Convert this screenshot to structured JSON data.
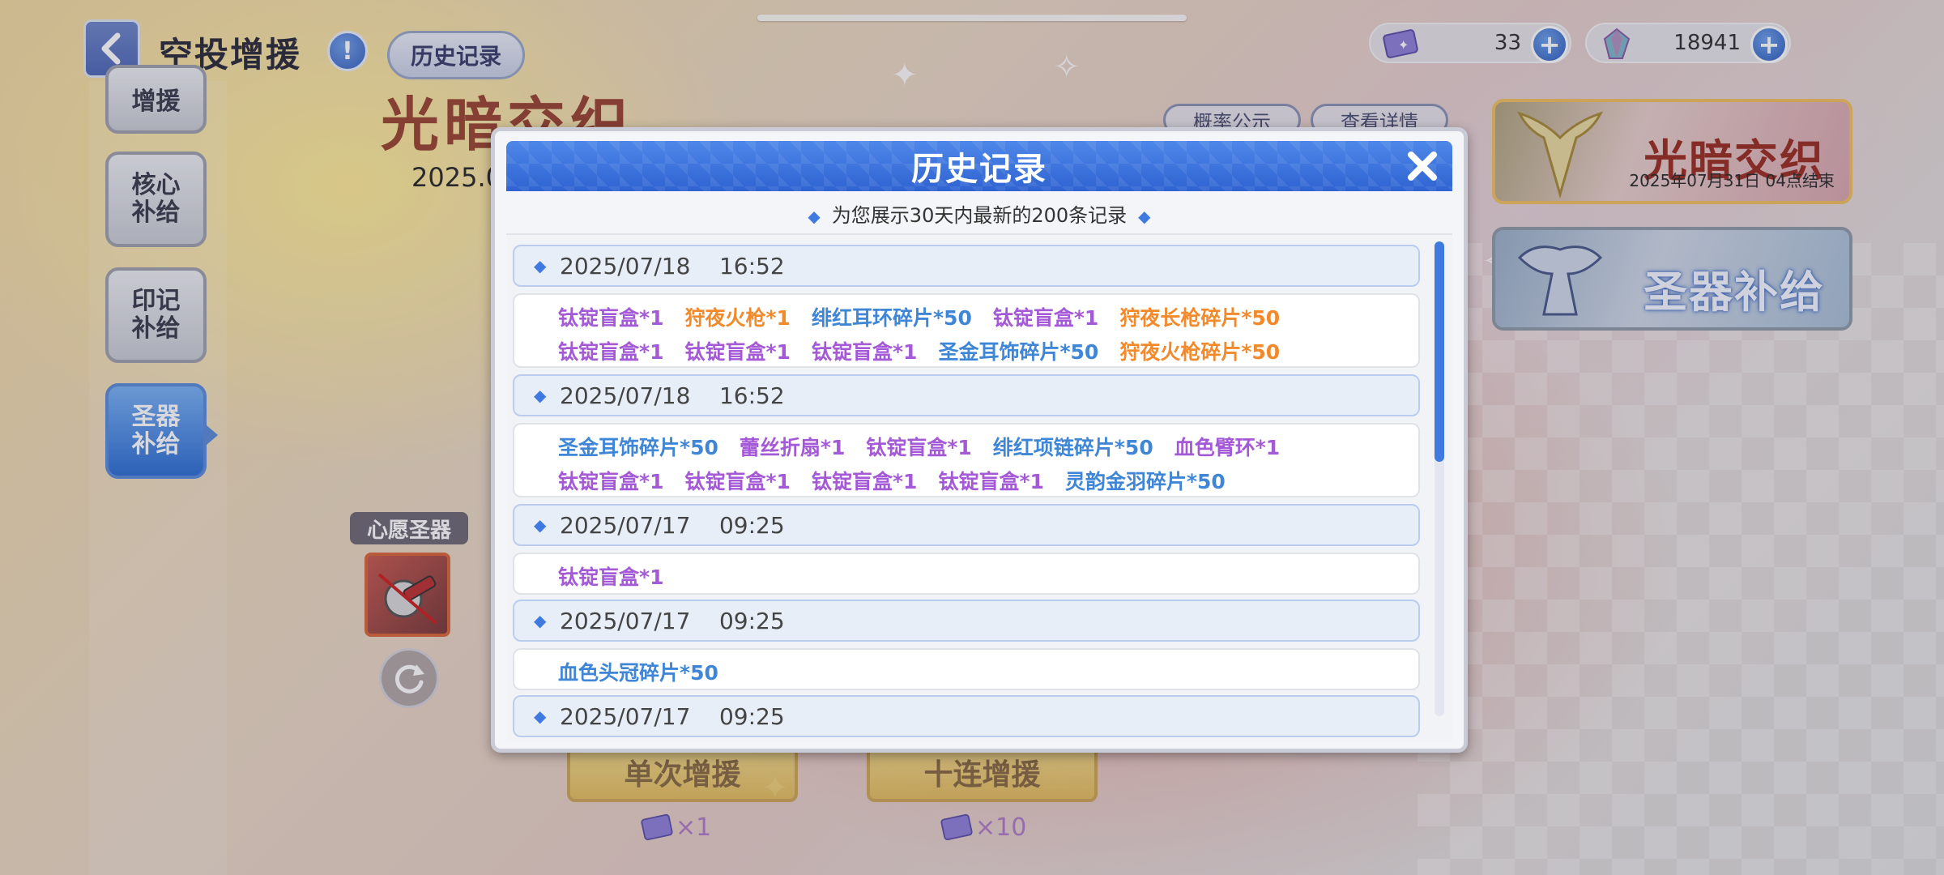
{
  "header": {
    "title": "空投增援",
    "history_button": "历史记录"
  },
  "currencies": [
    {
      "icon": "ticket-icon",
      "value": "33"
    },
    {
      "icon": "crystal-icon",
      "value": "18941"
    }
  ],
  "sidebar": {
    "tabs": [
      {
        "label": "增援",
        "active": false
      },
      {
        "label": "核心\n补给",
        "active": false
      },
      {
        "label": "印记\n补给",
        "active": false
      },
      {
        "label": "圣器\n补给",
        "active": true
      }
    ]
  },
  "wish": {
    "label": "心愿圣器"
  },
  "background": {
    "event_title": "光暗交织",
    "event_date": "2025.0",
    "small_btn_1": "概率公示",
    "small_btn_2": "查看详情",
    "single_pull": "单次增援",
    "ten_pull": "十连增援",
    "single_cost": "×1",
    "ten_cost": "×10"
  },
  "banners": [
    {
      "title": "光暗交织",
      "subtitle": "2025年07月31日 04点结束"
    },
    {
      "title": "圣器补给",
      "subtitle": ""
    }
  ],
  "modal": {
    "title": "历史记录",
    "subtitle": "为您展示30天内最新的200条记录",
    "records": [
      {
        "date": "2025/07/18    16:52",
        "items": [
          {
            "text": "钛锭盲盒*1",
            "color": "purple"
          },
          {
            "text": "狩夜火枪*1",
            "color": "orange"
          },
          {
            "text": "绯红耳环碎片*50",
            "color": "blue"
          },
          {
            "text": "钛锭盲盒*1",
            "color": "purple"
          },
          {
            "text": "狩夜长枪碎片*50",
            "color": "orange"
          },
          {
            "text": "钛锭盲盒*1",
            "color": "purple"
          },
          {
            "text": "钛锭盲盒*1",
            "color": "purple"
          },
          {
            "text": "钛锭盲盒*1",
            "color": "purple"
          },
          {
            "text": "圣金耳饰碎片*50",
            "color": "blue"
          },
          {
            "text": "狩夜火枪碎片*50",
            "color": "orange"
          }
        ]
      },
      {
        "date": "2025/07/18    16:52",
        "items": [
          {
            "text": "圣金耳饰碎片*50",
            "color": "blue"
          },
          {
            "text": "蕾丝折扇*1",
            "color": "purple"
          },
          {
            "text": "钛锭盲盒*1",
            "color": "purple"
          },
          {
            "text": "绯红项链碎片*50",
            "color": "blue"
          },
          {
            "text": "血色臂环*1",
            "color": "purple"
          },
          {
            "text": "钛锭盲盒*1",
            "color": "purple"
          },
          {
            "text": "钛锭盲盒*1",
            "color": "purple"
          },
          {
            "text": "钛锭盲盒*1",
            "color": "purple"
          },
          {
            "text": "钛锭盲盒*1",
            "color": "purple"
          },
          {
            "text": "灵韵金羽碎片*50",
            "color": "blue"
          }
        ]
      },
      {
        "date": "2025/07/17    09:25",
        "items": [
          {
            "text": "钛锭盲盒*1",
            "color": "purple"
          }
        ]
      },
      {
        "date": "2025/07/17    09:25",
        "items": [
          {
            "text": "血色头冠碎片*50",
            "color": "blue"
          }
        ]
      },
      {
        "date": "2025/07/17    09:25",
        "items": []
      }
    ]
  }
}
